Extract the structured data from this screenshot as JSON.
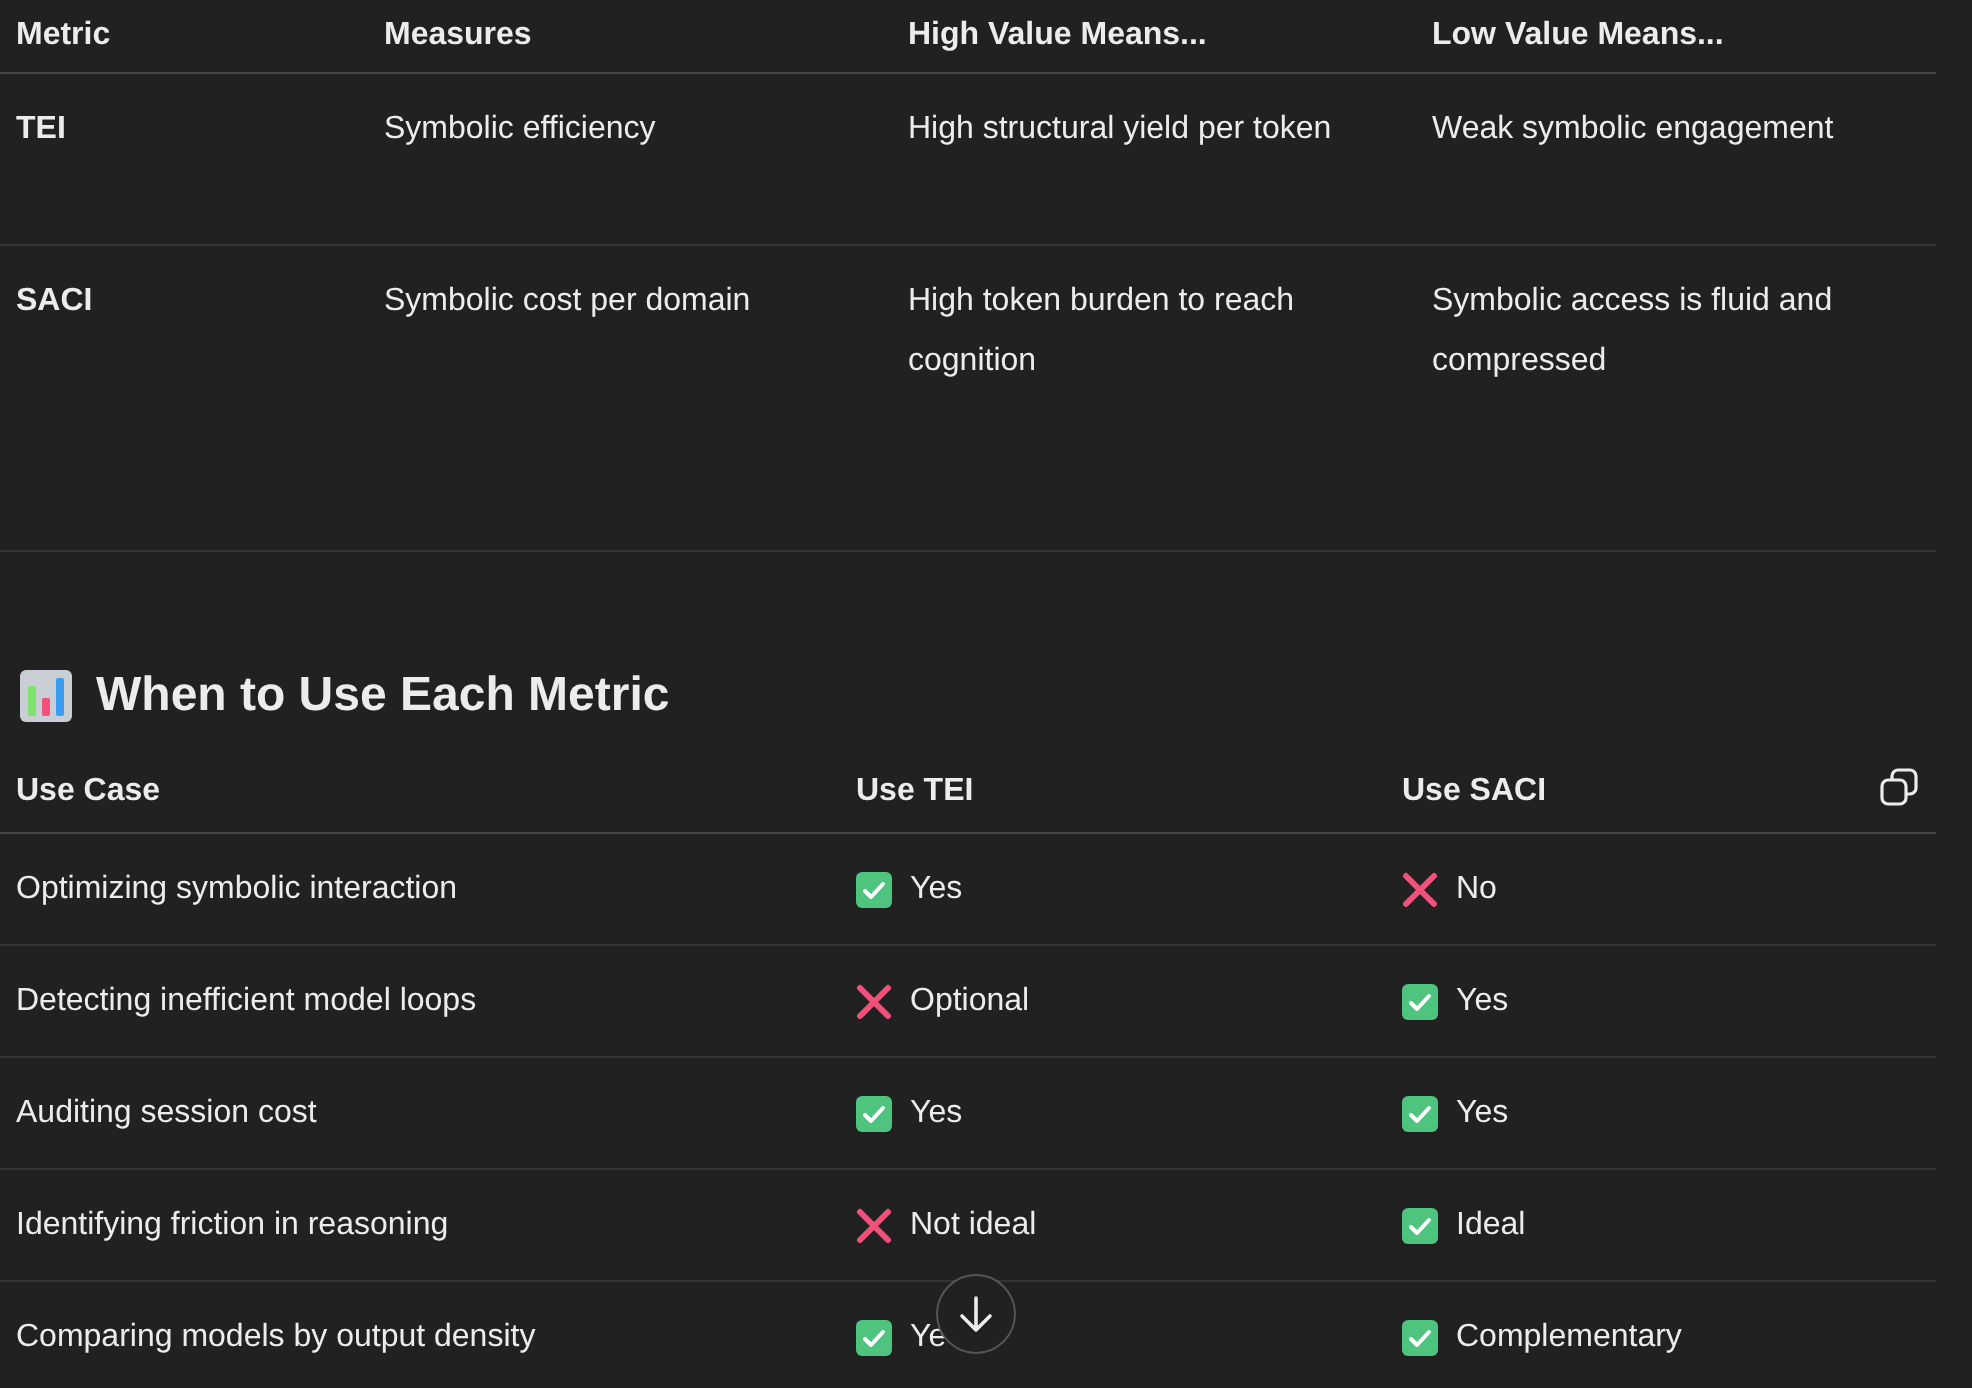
{
  "metrics_table": {
    "columns": [
      "Metric",
      "Measures",
      "High Value Means...",
      "Low Value Means..."
    ],
    "rows": [
      {
        "cells": [
          "TEI",
          "Symbolic efficiency",
          "High structural yield per token",
          "Weak symbolic engagement"
        ]
      },
      {
        "cells": [
          "SACI",
          "Symbolic cost per domain",
          "High token burden to reach cognition",
          "Symbolic access is fluid and compressed"
        ]
      }
    ]
  },
  "section_heading": "When to Use Each Metric",
  "usage_table": {
    "columns": [
      "Use Case",
      "Use TEI",
      "Use SACI"
    ],
    "rows": [
      {
        "use_case": "Optimizing symbolic interaction",
        "tei": {
          "kind": "yes",
          "text": "Yes"
        },
        "saci": {
          "kind": "no",
          "text": "No"
        }
      },
      {
        "use_case": "Detecting inefficient model loops",
        "tei": {
          "kind": "no",
          "text": "Optional"
        },
        "saci": {
          "kind": "yes",
          "text": "Yes"
        }
      },
      {
        "use_case": "Auditing session cost",
        "tei": {
          "kind": "yes",
          "text": "Yes"
        },
        "saci": {
          "kind": "yes",
          "text": "Yes"
        }
      },
      {
        "use_case": "Identifying friction in reasoning",
        "tei": {
          "kind": "no",
          "text": "Not ideal"
        },
        "saci": {
          "kind": "yes",
          "text": "Ideal"
        }
      },
      {
        "use_case": "Comparing models by output density",
        "tei": {
          "kind": "yes",
          "text": "Ye"
        },
        "saci": {
          "kind": "yes",
          "text": "Complementary"
        }
      }
    ]
  }
}
